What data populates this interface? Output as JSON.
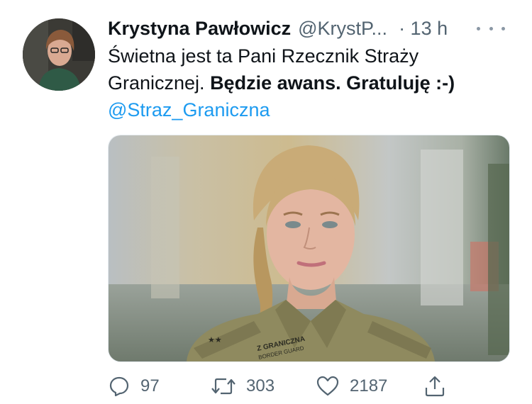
{
  "tweet": {
    "author": {
      "name": "Krystyna Pawłowicz",
      "handle": "@KrystP...",
      "time": "· 13 h"
    },
    "text": {
      "plain": "Świetna jest ta Pani Rzecznik Straży Granicznej. ",
      "bold": "Będzie awans. Gratuluję :-)",
      "mention": "@Straz_Graniczna"
    },
    "photo": {
      "shoulder_text_1": "Z GRANICZNA",
      "shoulder_text_2": "BORDER GUARD"
    },
    "actions": {
      "replies": "97",
      "retweets": "303",
      "likes": "2187"
    }
  },
  "icons": [
    "avatar-photo",
    "more-icon",
    "reply-icon",
    "retweet-icon",
    "like-icon",
    "share-icon"
  ],
  "colors": {
    "link": "#1d9bf0",
    "secondary_text": "#536471",
    "primary_text": "#0f1419"
  }
}
